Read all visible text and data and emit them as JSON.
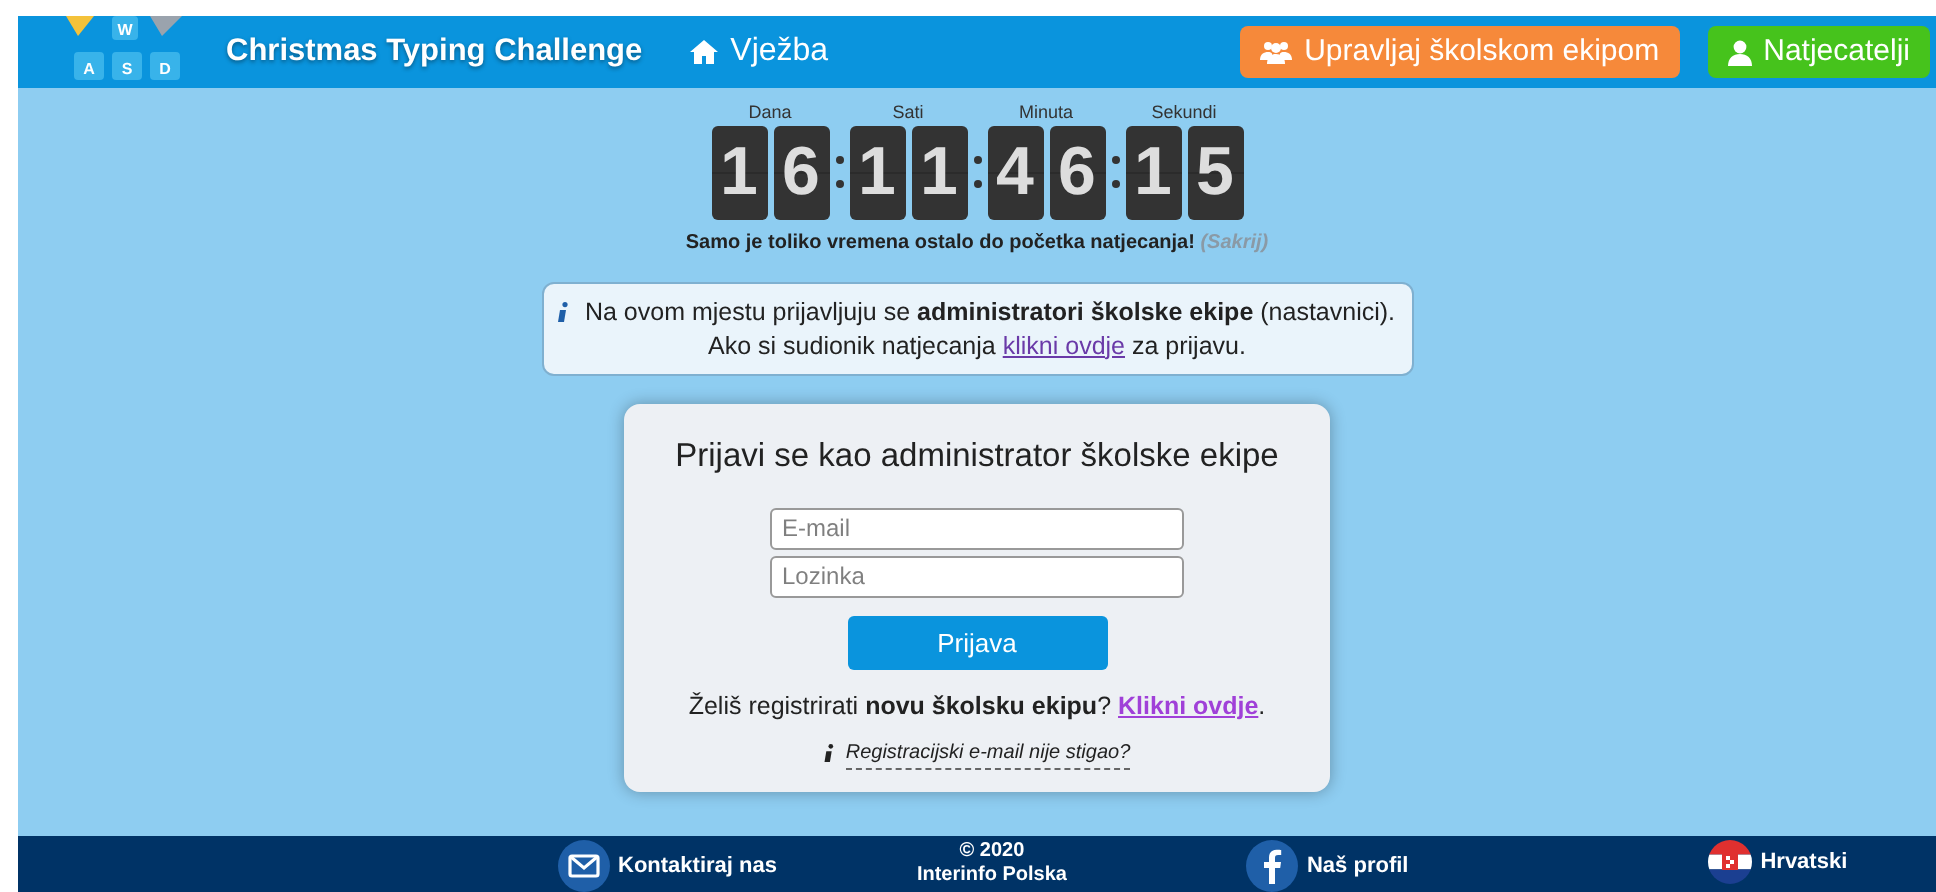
{
  "header": {
    "logo_keys": [
      "W",
      "A",
      "S",
      "D"
    ],
    "title": "Christmas Typing Challenge",
    "nav_link": "Vježba",
    "buttons": [
      {
        "kind": "team",
        "label": "Upravljaj školskom ekipom"
      },
      {
        "kind": "user",
        "label": "Natjecatelji"
      }
    ]
  },
  "countdown": {
    "units": [
      {
        "label": "Dana",
        "digits": [
          "1",
          "6"
        ]
      },
      {
        "label": "Sati",
        "digits": [
          "1",
          "1"
        ]
      },
      {
        "label": "Minuta",
        "digits": [
          "4",
          "6"
        ]
      },
      {
        "label": "Sekundi",
        "digits": [
          "1",
          "5"
        ]
      }
    ],
    "caption": "Samo je toliko vremena ostalo do početka natjecanja!",
    "hide_link": "(Sakrij)"
  },
  "notice": {
    "line1": "Na ovom mjestu prijavljuju se **administratori školske ekipe** (nastavnici).",
    "line2_before": "Ako si sudionik natjecanja",
    "link": "klikni ovdje",
    "line2_after": "za prijavu."
  },
  "login": {
    "title": "Prijavi se kao administrator školske ekipe",
    "email": {
      "placeholder": "E-mail"
    },
    "password": {
      "placeholder": "Lozinka"
    },
    "submit": "Prijava",
    "register_text": "Želiš registrirati **novu školsku ekipu**?",
    "register_link": "Klikni ovdje",
    "register_end": ".",
    "resend_link": "Registracijski e-mail nije stigao?"
  },
  "footer": {
    "items": [
      {
        "kind": "mail",
        "label": "Kontaktiraj nas"
      },
      {
        "kind": "copyright",
        "label": "© 2020",
        "sub": "Interinfo Polska"
      },
      {
        "kind": "facebook",
        "label": "Naš profil"
      },
      {
        "kind": "flag",
        "label": "Hrvatski"
      }
    ]
  }
}
